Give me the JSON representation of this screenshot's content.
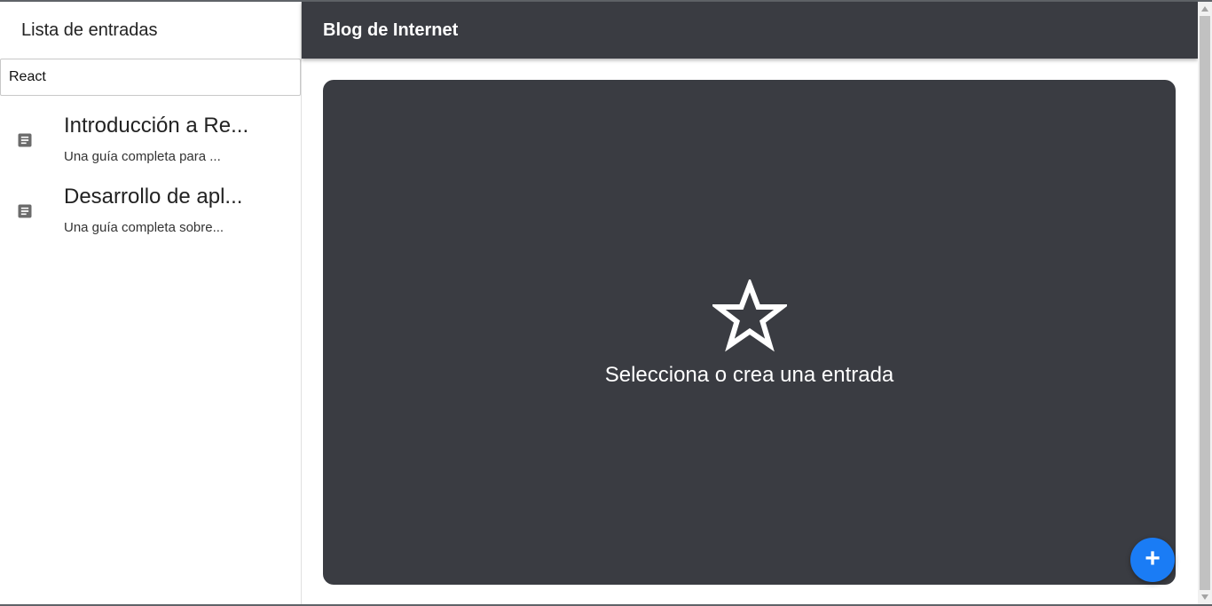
{
  "sidebar": {
    "title": "Lista de entradas",
    "search": {
      "value": "React",
      "placeholder": ""
    },
    "posts": [
      {
        "title": "Introducción a Re...",
        "excerpt": "Una guía completa para ...",
        "icon": "article-icon"
      },
      {
        "title": "Desarrollo de apl...",
        "excerpt": "Una guía completa sobre...",
        "icon": "article-icon"
      }
    ]
  },
  "header": {
    "title": "Blog de Internet"
  },
  "main": {
    "empty_icon": "star-outline-icon",
    "empty_message": "Selecciona o crea una entrada"
  },
  "fab": {
    "label": "+",
    "icon": "add-icon"
  },
  "colors": {
    "header_bg": "#3a3c42",
    "panel_bg": "#3a3c42",
    "fab_bg": "#1a7cf5",
    "icon_gray": "#6b6b6b"
  }
}
